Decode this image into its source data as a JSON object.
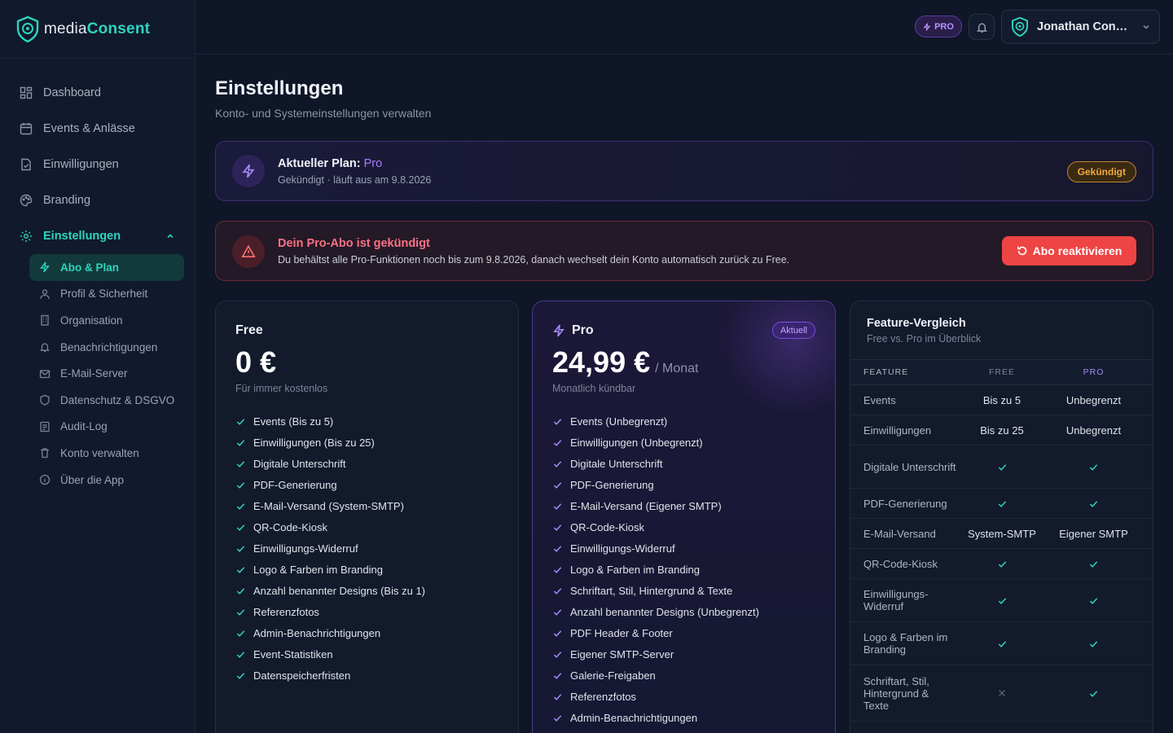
{
  "app": {
    "name_a": "media",
    "name_b": "Consent"
  },
  "sidebar": {
    "items": [
      {
        "label": "Dashboard",
        "icon": "dashboard-icon"
      },
      {
        "label": "Events & Anlässe",
        "icon": "calendar-icon"
      },
      {
        "label": "Einwilligungen",
        "icon": "file-check-icon"
      },
      {
        "label": "Branding",
        "icon": "palette-icon"
      },
      {
        "label": "Einstellungen",
        "icon": "gear-icon"
      }
    ],
    "sub_items": [
      {
        "label": "Abo & Plan",
        "icon": "bolt-icon"
      },
      {
        "label": "Profil & Sicherheit",
        "icon": "user-icon"
      },
      {
        "label": "Organisation",
        "icon": "building-icon"
      },
      {
        "label": "Benachrichtigungen",
        "icon": "bell-icon"
      },
      {
        "label": "E-Mail-Server",
        "icon": "mail-icon"
      },
      {
        "label": "Datenschutz & DSGVO",
        "icon": "shield-icon"
      },
      {
        "label": "Audit-Log",
        "icon": "log-icon"
      },
      {
        "label": "Konto verwalten",
        "icon": "trash-icon"
      },
      {
        "label": "Über die App",
        "icon": "info-icon"
      }
    ]
  },
  "topbar": {
    "pro_badge": "PRO",
    "user_name": "Jonathan Consent"
  },
  "page": {
    "title": "Einstellungen",
    "subtitle": "Konto- und Systemeinstellungen verwalten"
  },
  "plan": {
    "label": "Aktueller Plan:",
    "value": "Pro",
    "status_text": "Gekündigt · läuft aus am 9.8.2026",
    "badge": "Gekündigt"
  },
  "warning": {
    "title": "Dein Pro-Abo ist gekündigt",
    "text": "Du behältst alle Pro-Funktionen noch bis zum 9.8.2026, danach wechselt dein Konto automatisch zurück zu Free.",
    "button": "Abo reaktivieren"
  },
  "free_plan": {
    "name": "Free",
    "price": "0 €",
    "note": "Für immer kostenlos",
    "features": [
      "Events (Bis zu 5)",
      "Einwilligungen (Bis zu 25)",
      "Digitale Unterschrift",
      "PDF-Generierung",
      "E-Mail-Versand (System-SMTP)",
      "QR-Code-Kiosk",
      "Einwilligungs-Widerruf",
      "Logo & Farben im Branding",
      "Anzahl benannter Designs (Bis zu 1)",
      "Referenzfotos",
      "Admin-Benachrichtigungen",
      "Event-Statistiken",
      "Datenspeicherfristen"
    ]
  },
  "pro_plan": {
    "name": "Pro",
    "badge": "Aktuell",
    "price": "24,99 €",
    "period": "/ Monat",
    "note": "Monatlich kündbar",
    "features": [
      "Events (Unbegrenzt)",
      "Einwilligungen (Unbegrenzt)",
      "Digitale Unterschrift",
      "PDF-Generierung",
      "E-Mail-Versand (Eigener SMTP)",
      "QR-Code-Kiosk",
      "Einwilligungs-Widerruf",
      "Logo & Farben im Branding",
      "Schriftart, Stil, Hintergrund & Texte",
      "Anzahl benannter Designs (Unbegrenzt)",
      "PDF Header & Footer",
      "Eigener SMTP-Server",
      "Galerie-Freigaben",
      "Referenzfotos",
      "Admin-Benachrichtigungen"
    ]
  },
  "comparison": {
    "title": "Feature-Vergleich",
    "subtitle": "Free vs. Pro im Überblick",
    "headers": [
      "FEATURE",
      "FREE",
      "PRO"
    ],
    "rows": [
      {
        "feature": "Events",
        "free": "Bis zu 5",
        "pro": "Unbegrenzt"
      },
      {
        "feature": "Einwilligungen",
        "free": "Bis zu 25",
        "pro": "Unbegrenzt"
      },
      {
        "feature": "Digitale Unterschrift",
        "free": "check",
        "pro": "check"
      },
      {
        "feature": "PDF-Generierung",
        "free": "check",
        "pro": "check"
      },
      {
        "feature": "E-Mail-Versand",
        "free": "System-SMTP",
        "pro": "Eigener SMTP"
      },
      {
        "feature": "QR-Code-Kiosk",
        "free": "check",
        "pro": "check"
      },
      {
        "feature": "Einwilligungs-Widerruf",
        "free": "check",
        "pro": "check"
      },
      {
        "feature": "Logo & Farben im Branding",
        "free": "check",
        "pro": "check"
      },
      {
        "feature": "Schriftart, Stil, Hintergrund & Texte",
        "free": "cross",
        "pro": "check"
      }
    ]
  },
  "colors": {
    "accent": "#2dd4bf",
    "pro": "#a78bfa",
    "danger": "#ef4444",
    "warning": "#f0a83a"
  }
}
